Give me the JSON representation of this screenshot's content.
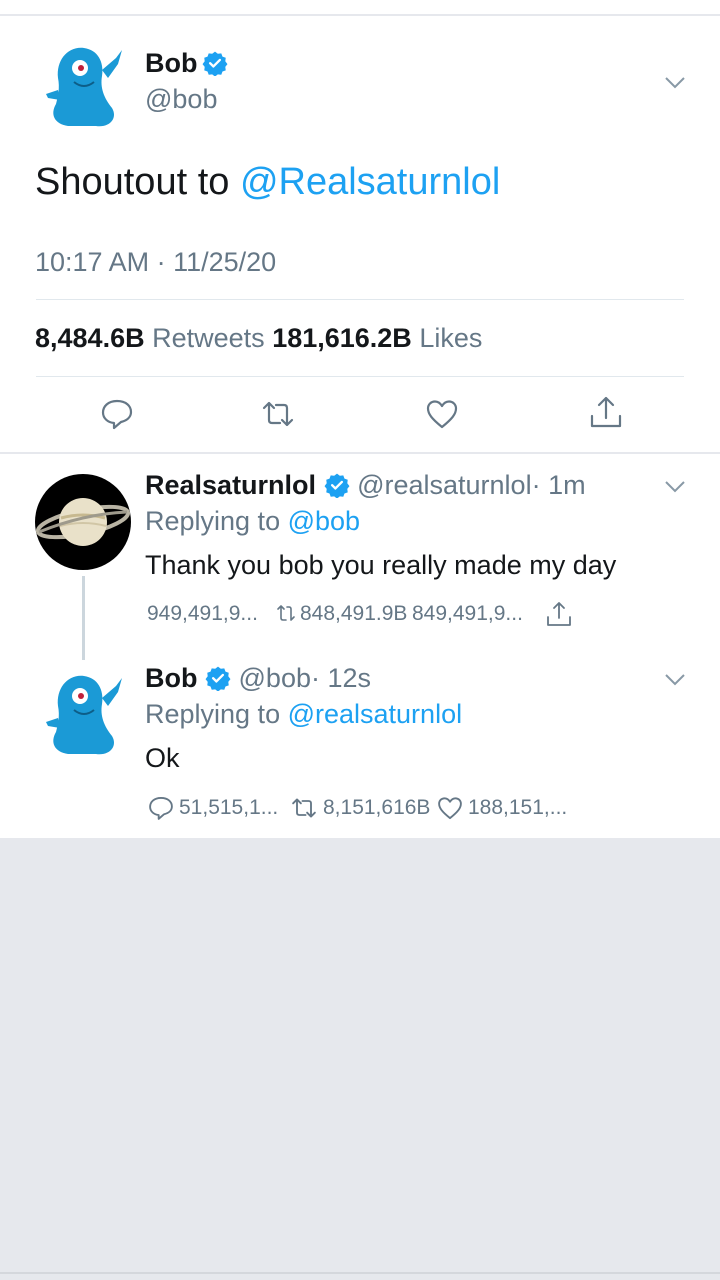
{
  "main_tweet": {
    "author_name": "Bob",
    "author_handle": "@bob",
    "text_prefix": "Shoutout to ",
    "text_mention": "@Realsaturnlol",
    "timestamp": "10:17 AM · 11/25/20",
    "retweet_count": "8,484.6B",
    "retweet_label": "Retweets",
    "like_count": "181,616.2B",
    "like_label": "Likes"
  },
  "reply_1": {
    "author_name": "Realsaturnlol",
    "author_handle": "@realsaturnlol",
    "time": "· 1m",
    "replying_prefix": "Replying to ",
    "replying_to": "@bob",
    "text": "Thank you bob you really made my day",
    "reply_count": "949,491,9...",
    "retweet_count": "848,491.9B",
    "like_count": "849,491,9..."
  },
  "reply_2": {
    "author_name": "Bob",
    "author_handle": "@bob",
    "time": "· 12s",
    "replying_prefix": "Replying to ",
    "replying_to": "@realsaturnlol",
    "text": "Ok",
    "reply_count": "51,515,1...",
    "retweet_count": "8,151,616B",
    "like_count": "188,151,..."
  },
  "icons": {
    "verified": "verified-badge-icon",
    "menu": "chevron-down-icon",
    "reply": "comment-icon",
    "retweet": "retweet-icon",
    "like": "heart-icon",
    "share": "share-icon"
  },
  "colors": {
    "accent": "#1da1f2",
    "secondary_text": "#657786",
    "background_empty": "#e6e8ed"
  }
}
